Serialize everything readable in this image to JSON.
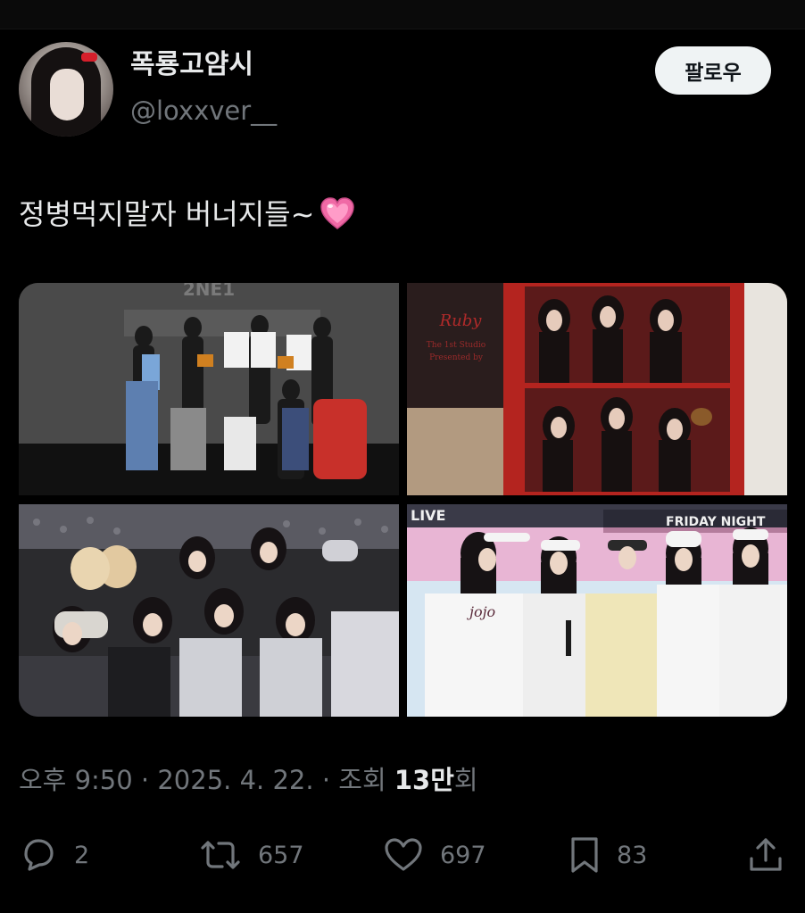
{
  "tweet": {
    "display_name": "폭룡고얌시",
    "handle": "@loxxver__",
    "follow_label": "팔로우",
    "text": "정병먹지말자 버너지들~",
    "emoji": "heart-emoji",
    "photo_text": {
      "banner": "2NE1",
      "card_script": "Ruby",
      "card_line1": "The 1st Studio",
      "card_line2": "Presented by",
      "stage_live": "LIVE",
      "stage_friday": "FRIDAY NIGHT",
      "shirt": "jojo"
    },
    "meta": {
      "time": "오후 9:50",
      "sep": " · ",
      "date": "2025. 4. 22.",
      "views_prefix": "조회 ",
      "views_count": "13만",
      "views_suffix": "회"
    },
    "actions": {
      "replies": "2",
      "retweets": "657",
      "likes": "697",
      "bookmarks": "83"
    }
  },
  "colors": {
    "background": "#000000",
    "text_primary": "#e7e9ea",
    "text_secondary": "#71767b",
    "follow_bg": "#eff3f4",
    "heart_pink": "#f06aa6"
  }
}
